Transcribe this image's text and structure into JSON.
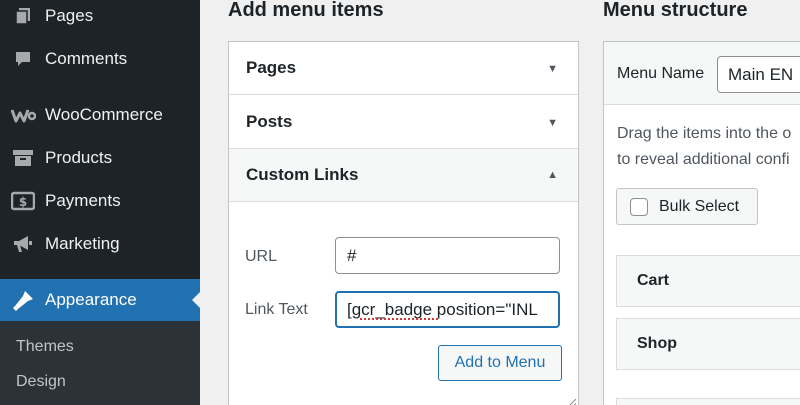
{
  "sidebar": {
    "items": [
      {
        "label": "Pages",
        "icon": "pages-icon"
      },
      {
        "label": "Comments",
        "icon": "comments-icon"
      },
      {
        "label": "WooCommerce",
        "icon": "woocommerce-icon"
      },
      {
        "label": "Products",
        "icon": "products-icon"
      },
      {
        "label": "Payments",
        "icon": "payments-icon"
      },
      {
        "label": "Marketing",
        "icon": "marketing-icon"
      },
      {
        "label": "Appearance",
        "icon": "appearance-icon",
        "active": true
      }
    ],
    "submenu": [
      {
        "label": "Themes"
      },
      {
        "label": "Design"
      }
    ]
  },
  "add_menu_items": {
    "heading": "Add menu items",
    "sections": [
      {
        "label": "Pages",
        "state": "collapsed"
      },
      {
        "label": "Posts",
        "state": "collapsed"
      },
      {
        "label": "Custom Links",
        "state": "expanded"
      }
    ],
    "custom_links": {
      "url_label": "URL",
      "url_value": "#",
      "link_text_label": "Link Text",
      "link_text_value": "[gcr_badge position=\"INL",
      "add_button_label": "Add to Menu"
    }
  },
  "menu_structure": {
    "heading": "Menu structure",
    "menu_name_label": "Menu Name",
    "menu_name_value": "Main EN",
    "instructions_line1": "Drag the items into the o",
    "instructions_line2": "to reveal additional confi",
    "bulk_select_label": "Bulk Select",
    "items": [
      {
        "label": "Cart"
      },
      {
        "label": "Shop"
      }
    ]
  },
  "colors": {
    "sidebar_bg": "#1d2327",
    "accent": "#2271b1",
    "page_bg": "#f0f0f1"
  }
}
